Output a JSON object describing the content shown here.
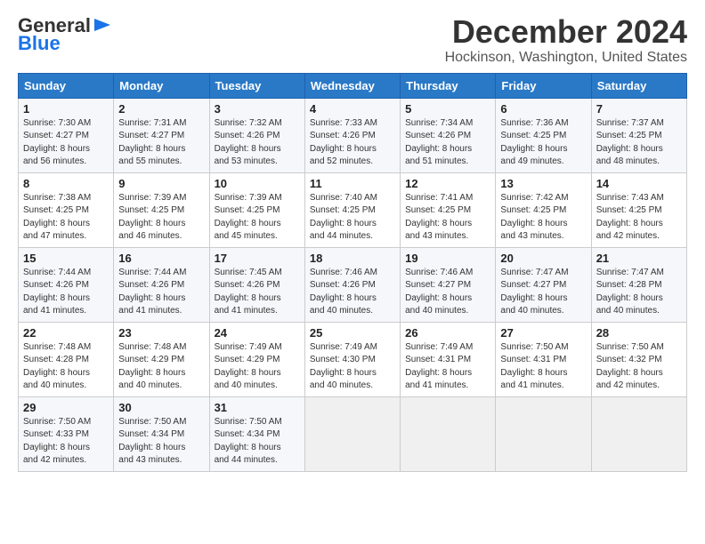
{
  "logo": {
    "text_general": "General",
    "text_blue": "Blue"
  },
  "header": {
    "month": "December 2024",
    "location": "Hockinson, Washington, United States"
  },
  "weekdays": [
    "Sunday",
    "Monday",
    "Tuesday",
    "Wednesday",
    "Thursday",
    "Friday",
    "Saturday"
  ],
  "days": [
    {
      "num": "",
      "info": ""
    },
    {
      "num": "",
      "info": ""
    },
    {
      "num": "",
      "info": ""
    },
    {
      "num": "1",
      "info": "Sunrise: 7:30 AM\nSunset: 4:27 PM\nDaylight: 8 hours\nand 56 minutes."
    },
    {
      "num": "2",
      "info": "Sunrise: 7:31 AM\nSunset: 4:27 PM\nDaylight: 8 hours\nand 55 minutes."
    },
    {
      "num": "3",
      "info": "Sunrise: 7:32 AM\nSunset: 4:26 PM\nDaylight: 8 hours\nand 53 minutes."
    },
    {
      "num": "4",
      "info": "Sunrise: 7:33 AM\nSunset: 4:26 PM\nDaylight: 8 hours\nand 52 minutes."
    },
    {
      "num": "5",
      "info": "Sunrise: 7:34 AM\nSunset: 4:26 PM\nDaylight: 8 hours\nand 51 minutes."
    },
    {
      "num": "6",
      "info": "Sunrise: 7:36 AM\nSunset: 4:25 PM\nDaylight: 8 hours\nand 49 minutes."
    },
    {
      "num": "7",
      "info": "Sunrise: 7:37 AM\nSunset: 4:25 PM\nDaylight: 8 hours\nand 48 minutes."
    },
    {
      "num": "8",
      "info": "Sunrise: 7:38 AM\nSunset: 4:25 PM\nDaylight: 8 hours\nand 47 minutes."
    },
    {
      "num": "9",
      "info": "Sunrise: 7:39 AM\nSunset: 4:25 PM\nDaylight: 8 hours\nand 46 minutes."
    },
    {
      "num": "10",
      "info": "Sunrise: 7:39 AM\nSunset: 4:25 PM\nDaylight: 8 hours\nand 45 minutes."
    },
    {
      "num": "11",
      "info": "Sunrise: 7:40 AM\nSunset: 4:25 PM\nDaylight: 8 hours\nand 44 minutes."
    },
    {
      "num": "12",
      "info": "Sunrise: 7:41 AM\nSunset: 4:25 PM\nDaylight: 8 hours\nand 43 minutes."
    },
    {
      "num": "13",
      "info": "Sunrise: 7:42 AM\nSunset: 4:25 PM\nDaylight: 8 hours\nand 43 minutes."
    },
    {
      "num": "14",
      "info": "Sunrise: 7:43 AM\nSunset: 4:25 PM\nDaylight: 8 hours\nand 42 minutes."
    },
    {
      "num": "15",
      "info": "Sunrise: 7:44 AM\nSunset: 4:26 PM\nDaylight: 8 hours\nand 41 minutes."
    },
    {
      "num": "16",
      "info": "Sunrise: 7:44 AM\nSunset: 4:26 PM\nDaylight: 8 hours\nand 41 minutes."
    },
    {
      "num": "17",
      "info": "Sunrise: 7:45 AM\nSunset: 4:26 PM\nDaylight: 8 hours\nand 41 minutes."
    },
    {
      "num": "18",
      "info": "Sunrise: 7:46 AM\nSunset: 4:26 PM\nDaylight: 8 hours\nand 40 minutes."
    },
    {
      "num": "19",
      "info": "Sunrise: 7:46 AM\nSunset: 4:27 PM\nDaylight: 8 hours\nand 40 minutes."
    },
    {
      "num": "20",
      "info": "Sunrise: 7:47 AM\nSunset: 4:27 PM\nDaylight: 8 hours\nand 40 minutes."
    },
    {
      "num": "21",
      "info": "Sunrise: 7:47 AM\nSunset: 4:28 PM\nDaylight: 8 hours\nand 40 minutes."
    },
    {
      "num": "22",
      "info": "Sunrise: 7:48 AM\nSunset: 4:28 PM\nDaylight: 8 hours\nand 40 minutes."
    },
    {
      "num": "23",
      "info": "Sunrise: 7:48 AM\nSunset: 4:29 PM\nDaylight: 8 hours\nand 40 minutes."
    },
    {
      "num": "24",
      "info": "Sunrise: 7:49 AM\nSunset: 4:29 PM\nDaylight: 8 hours\nand 40 minutes."
    },
    {
      "num": "25",
      "info": "Sunrise: 7:49 AM\nSunset: 4:30 PM\nDaylight: 8 hours\nand 40 minutes."
    },
    {
      "num": "26",
      "info": "Sunrise: 7:49 AM\nSunset: 4:31 PM\nDaylight: 8 hours\nand 41 minutes."
    },
    {
      "num": "27",
      "info": "Sunrise: 7:50 AM\nSunset: 4:31 PM\nDaylight: 8 hours\nand 41 minutes."
    },
    {
      "num": "28",
      "info": "Sunrise: 7:50 AM\nSunset: 4:32 PM\nDaylight: 8 hours\nand 42 minutes."
    },
    {
      "num": "29",
      "info": "Sunrise: 7:50 AM\nSunset: 4:33 PM\nDaylight: 8 hours\nand 42 minutes."
    },
    {
      "num": "30",
      "info": "Sunrise: 7:50 AM\nSunset: 4:34 PM\nDaylight: 8 hours\nand 43 minutes."
    },
    {
      "num": "31",
      "info": "Sunrise: 7:50 AM\nSunset: 4:34 PM\nDaylight: 8 hours\nand 44 minutes."
    },
    {
      "num": "",
      "info": ""
    },
    {
      "num": "",
      "info": ""
    },
    {
      "num": "",
      "info": ""
    },
    {
      "num": "",
      "info": ""
    }
  ]
}
